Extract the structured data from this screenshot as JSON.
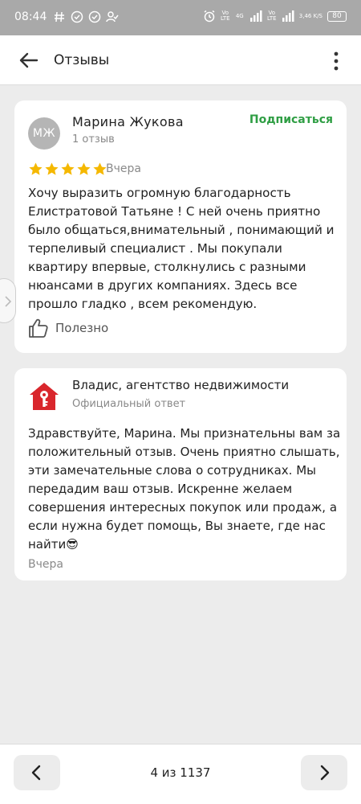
{
  "status_bar": {
    "time": "08:44",
    "net1": "Vo LTE",
    "net2": "4G",
    "net3": "Vo LTE",
    "speed": "3,46 K/S",
    "battery": "80",
    "icon_color": "#ffffff"
  },
  "header": {
    "title": "Отзывы",
    "back_icon": "arrow-left-icon",
    "menu_icon": "more-vert-icon"
  },
  "review": {
    "avatar_initials": "МЖ",
    "author": "Марина Жукова",
    "review_count": "1 отзыв",
    "subscribe_label": "Подписаться",
    "rating": 5,
    "date": "Вчера",
    "text": "Хочу выразить огромную благодарность Елистратовой Татьяне ! С ней очень приятно было общаться,внимательный , понимающий и терпеливый специалист . Мы покупали квартиру впервые, столкнулись с разными нюансами в других компаниях. Здесь все прошло гладко , всем рекомендую.",
    "helpful_label": "Полезно"
  },
  "reply": {
    "agency": "Владис, агентство недвижимости",
    "label": "Официальный ответ",
    "text": "Здравствуйте, Марина. Мы признательны вам за положительный отзыв. Очень приятно слышать, эти замечательные слова о сотрудниках. Мы передадим ваш отзыв. Искренне желаем совершения интересных покупок или продаж, а если нужна будет помощь, Вы знаете, где нас найти😎",
    "date": "Вчера"
  },
  "pagination": {
    "text": "4 из 1137"
  },
  "colors": {
    "accent_green": "#2f9e44",
    "star": "#f5b800",
    "logo_red": "#d9262c"
  }
}
